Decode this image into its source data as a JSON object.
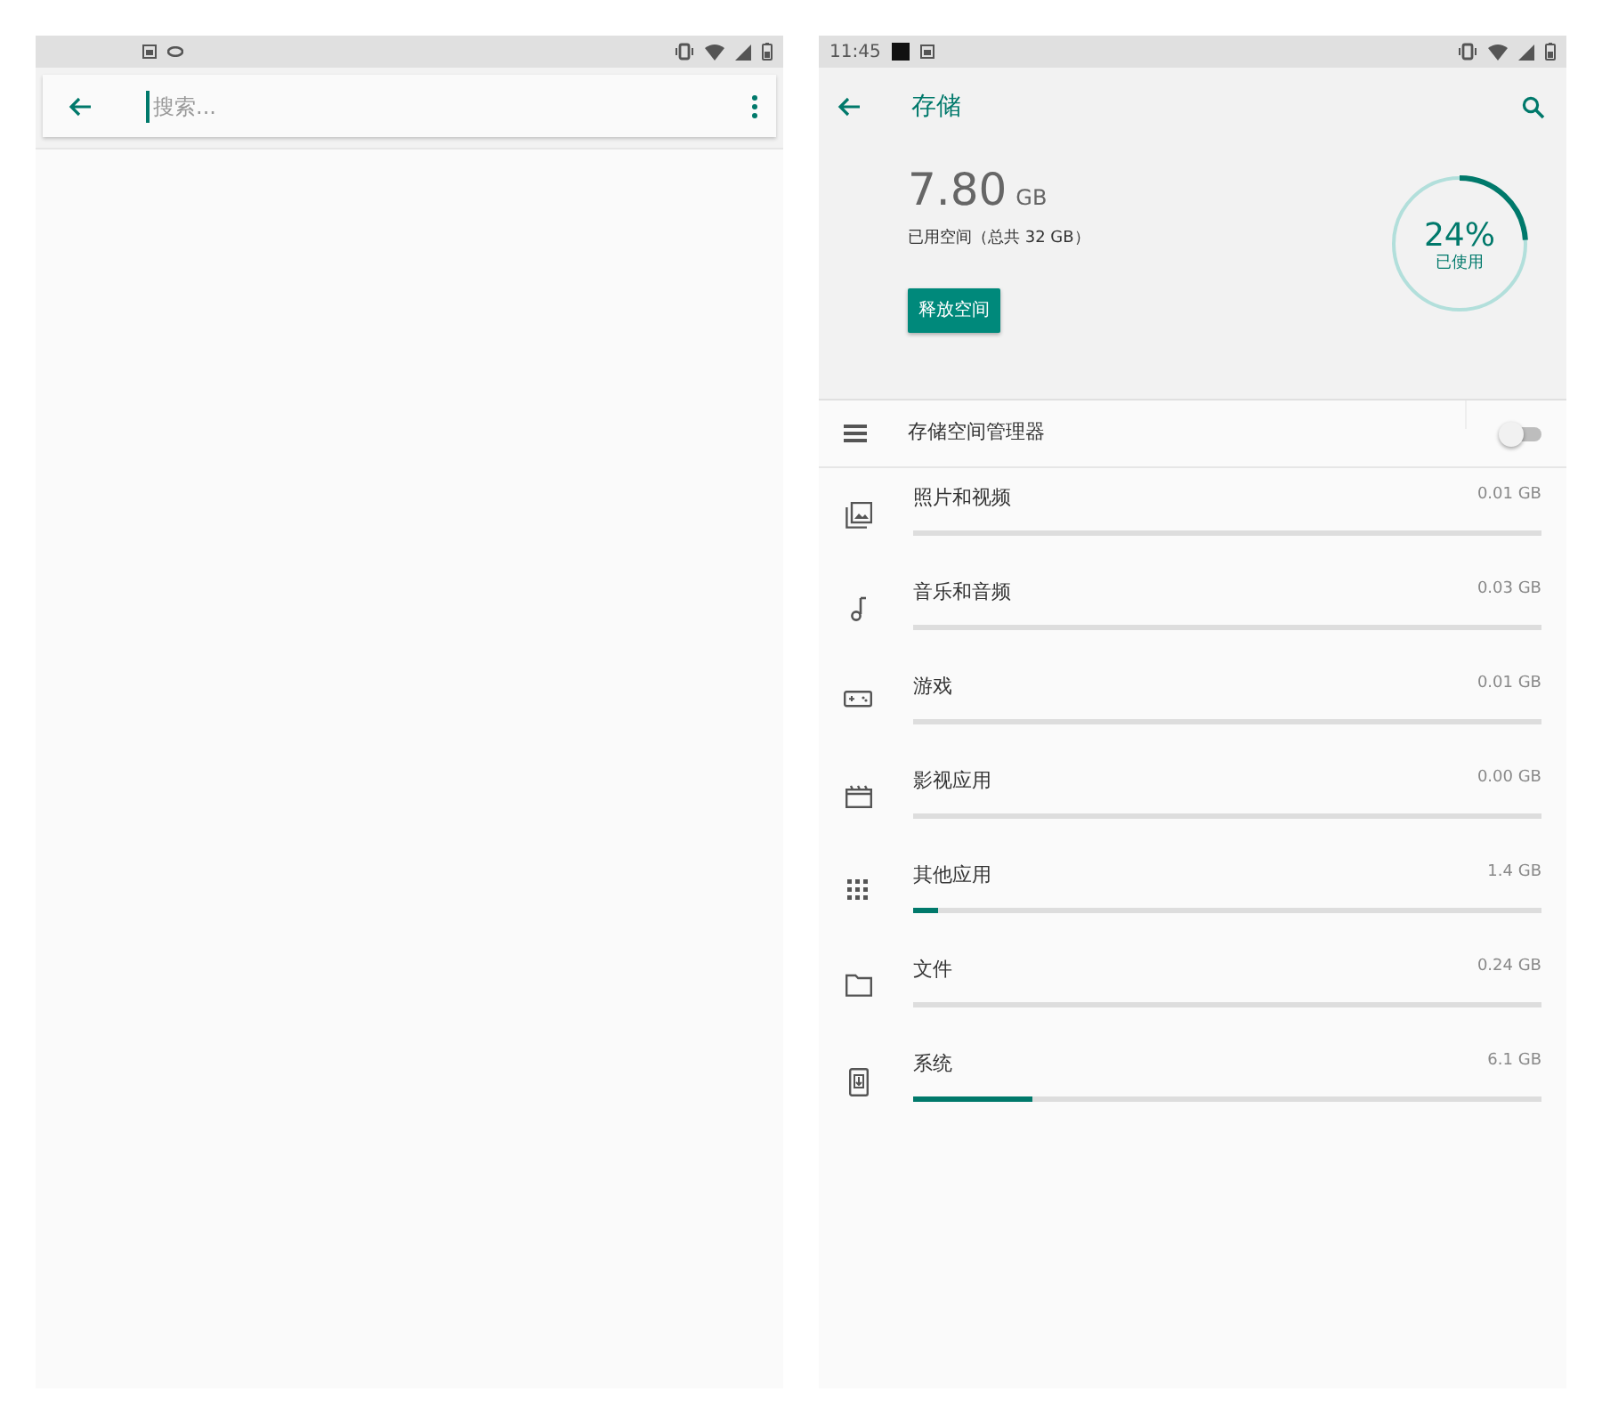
{
  "left_screen": {
    "search_bar": {
      "placeholder": "搜索..."
    }
  },
  "right_screen": {
    "status_bar": {
      "time": "11:45"
    },
    "app_bar": {
      "title": "存储"
    },
    "summary": {
      "used": "7.80",
      "unit": "GB",
      "caption": "已用空间（总共 32 GB）",
      "button": "释放空间",
      "donut": {
        "level": 0.24,
        "percent": "24%",
        "label": "已使用"
      }
    },
    "manager": {
      "label": "存储空间管理器",
      "on": false
    },
    "categories": [
      {
        "kind": "photos",
        "label": "照片和视频",
        "size": "0.01 GB",
        "level": 0
      },
      {
        "kind": "music",
        "label": "音乐和音频",
        "size": "0.03 GB",
        "level": 0
      },
      {
        "kind": "games",
        "label": "游戏",
        "size": "0.01 GB",
        "level": 0
      },
      {
        "kind": "movies",
        "label": "影视应用",
        "size": "0.00 GB",
        "level": 0
      },
      {
        "kind": "apps",
        "label": "其他应用",
        "size": "1.4 GB",
        "level": 0.04
      },
      {
        "kind": "files",
        "label": "文件",
        "size": "0.24 GB",
        "level": 0
      },
      {
        "kind": "system",
        "label": "系统",
        "size": "6.1 GB",
        "level": 0.19
      }
    ]
  }
}
